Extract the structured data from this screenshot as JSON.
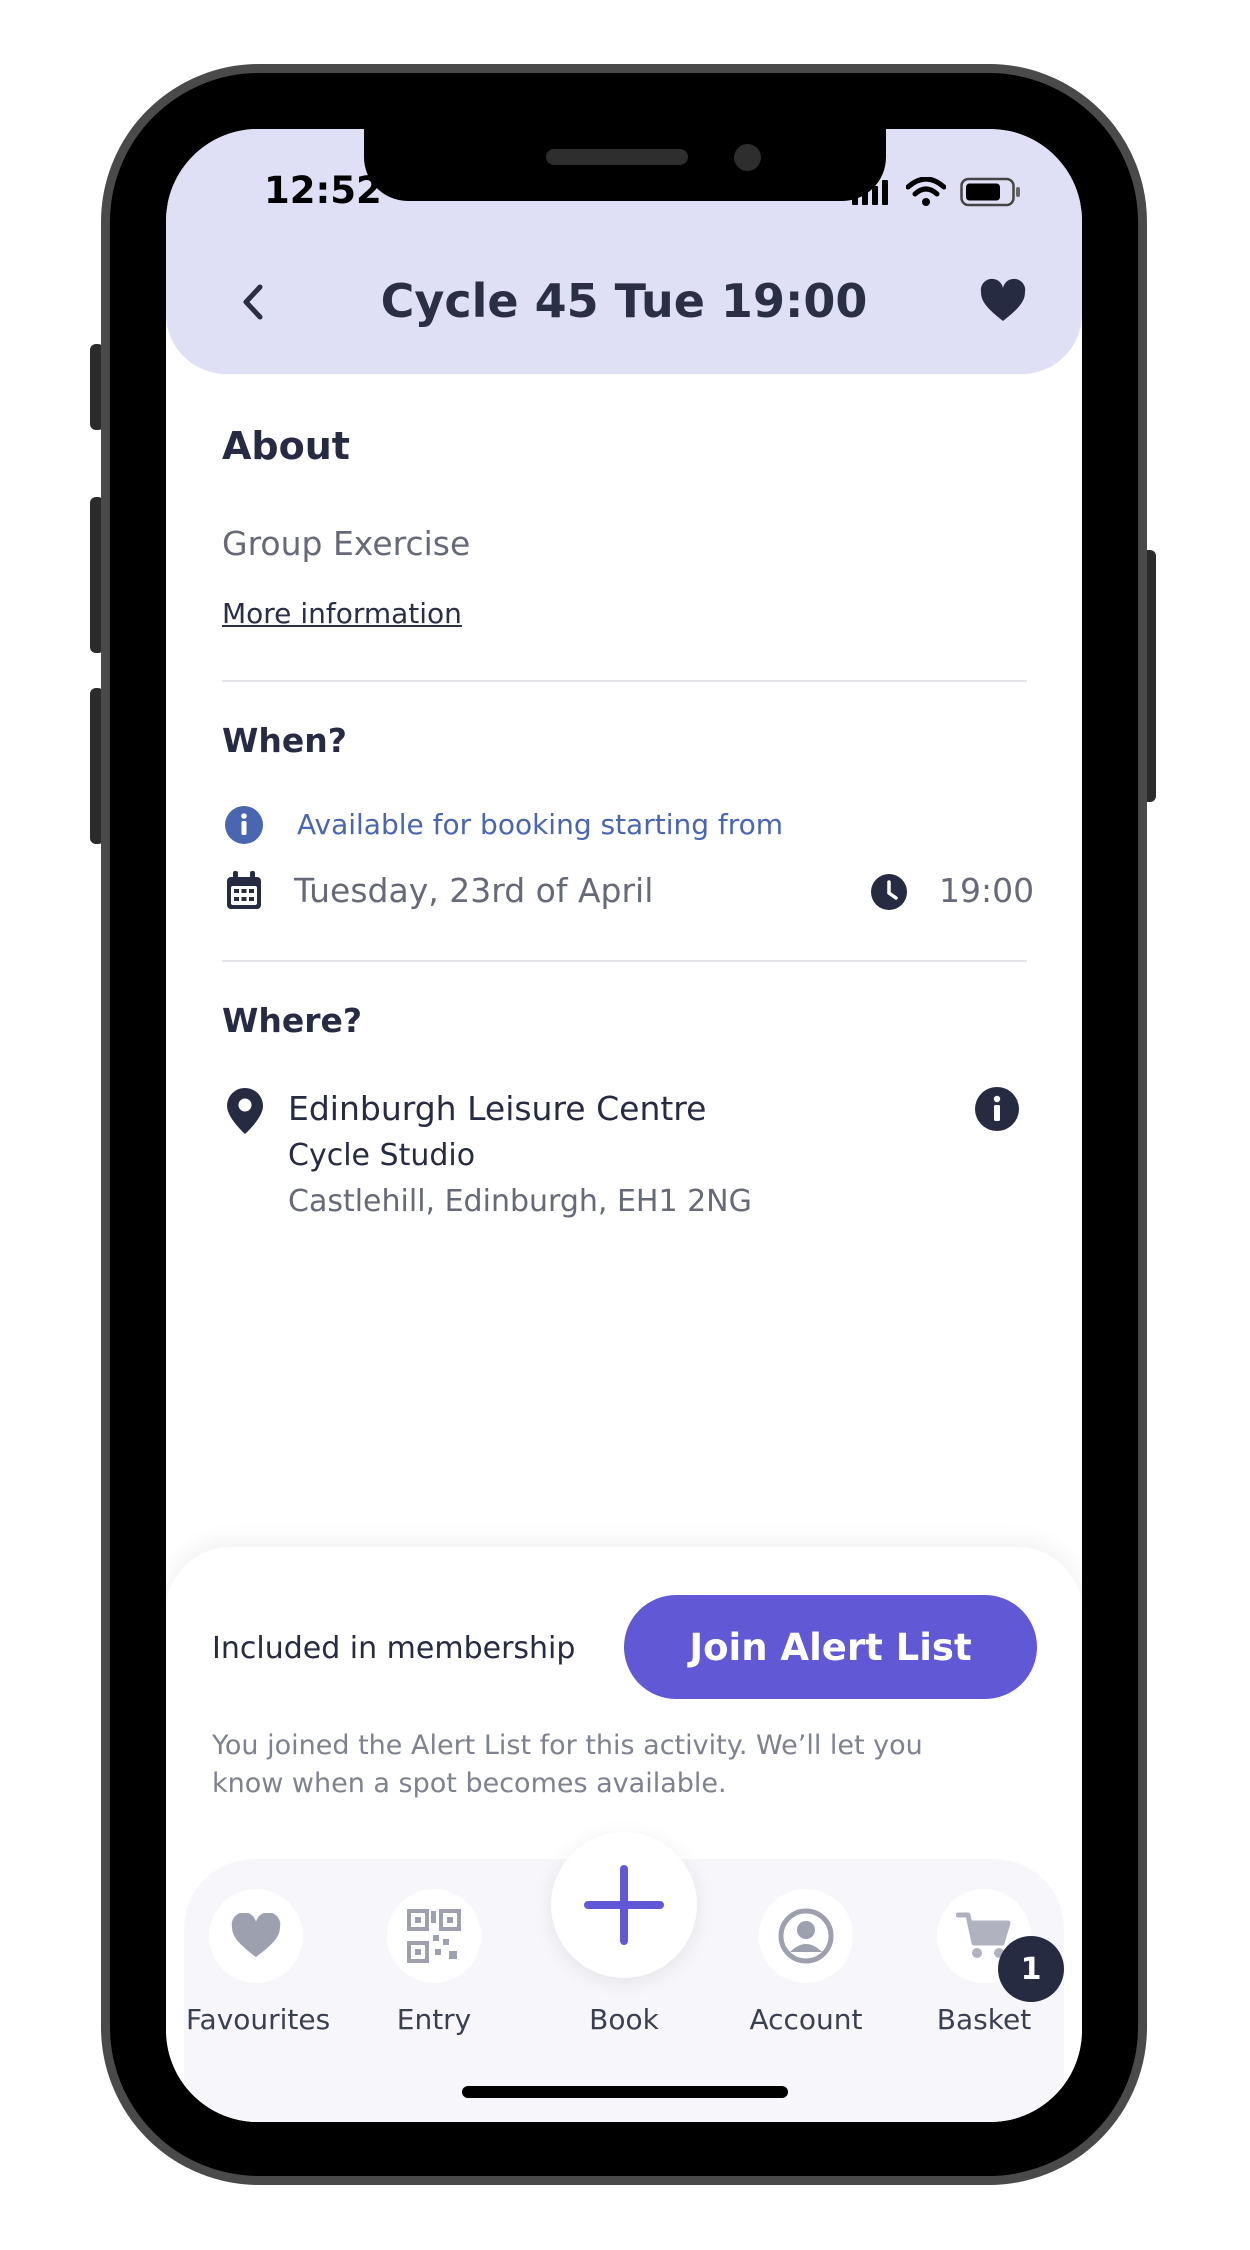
{
  "status_bar": {
    "time": "12:52"
  },
  "header": {
    "title": "Cycle 45 Tue 19:00"
  },
  "about": {
    "heading": "About",
    "category": "Group Exercise",
    "more_link": "More information"
  },
  "when": {
    "heading": "When?",
    "availability_note": "Available for booking starting from",
    "date": "Tuesday, 23rd of April",
    "time": "19:00"
  },
  "where": {
    "heading": "Where?",
    "venue": "Edinburgh Leisure Centre",
    "room": "Cycle Studio",
    "address": "Castlehill, Edinburgh, EH1 2NG"
  },
  "booking": {
    "membership_label": "Included in membership",
    "join_button": "Join Alert List",
    "alert_message": "You joined the Alert List for this activity. We’ll let you know when a spot becomes available."
  },
  "tab_bar": {
    "items": [
      {
        "label": "Favourites",
        "icon": "heart-icon"
      },
      {
        "label": "Entry",
        "icon": "qr-code-icon"
      },
      {
        "label": "Book",
        "icon": "plus-icon"
      },
      {
        "label": "Account",
        "icon": "user-icon"
      },
      {
        "label": "Basket",
        "icon": "cart-icon"
      }
    ],
    "basket_count": "1"
  },
  "colors": {
    "header_bg": "#dfdff5",
    "accent": "#6058d4",
    "info_blue": "#4a66b0",
    "dark": "#262b42"
  }
}
